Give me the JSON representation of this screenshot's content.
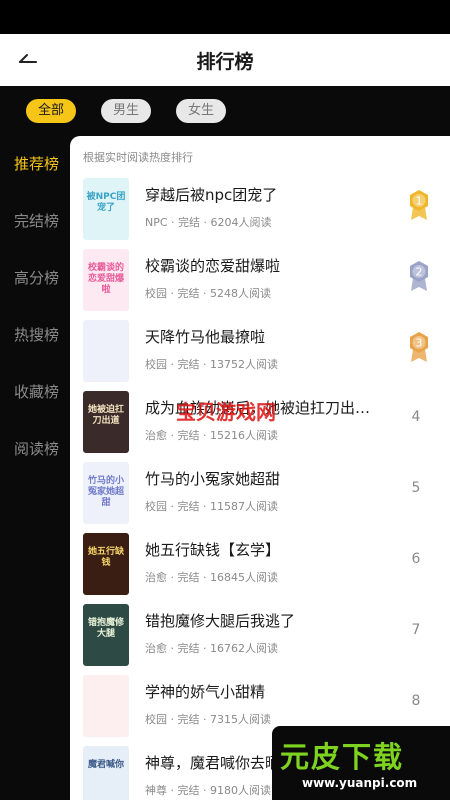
{
  "header": {
    "title": "排行榜"
  },
  "tabs": [
    {
      "label": "全部",
      "active": true
    },
    {
      "label": "男生",
      "active": false
    },
    {
      "label": "女生",
      "active": false
    }
  ],
  "sidebar": [
    {
      "label": "推荐榜",
      "active": true
    },
    {
      "label": "完结榜",
      "active": false
    },
    {
      "label": "高分榜",
      "active": false
    },
    {
      "label": "热搜榜",
      "active": false
    },
    {
      "label": "收藏榜",
      "active": false
    },
    {
      "label": "阅读榜",
      "active": false
    }
  ],
  "panel_hint": "根据实时阅读热度排行",
  "books": [
    {
      "title": "穿越后被npc团宠了",
      "meta": "NPC · 完结 · 6204人阅读",
      "rank": "1",
      "medal": "gold",
      "cover_text": "被NPC团宠了",
      "cover_bg": "#dff4f6",
      "cover_fg": "#3aa3c6"
    },
    {
      "title": "校霸谈的恋爱甜爆啦",
      "meta": "校园 · 完结 · 5248人阅读",
      "rank": "2",
      "medal": "silver",
      "cover_text": "校霸谈的恋爱甜爆啦",
      "cover_bg": "#fde9f1",
      "cover_fg": "#e85d9a"
    },
    {
      "title": "天降竹马他最撩啦",
      "meta": "校园 · 完结 · 13752人阅读",
      "rank": "3",
      "medal": "bronze",
      "cover_text": "",
      "cover_bg": "#eef1f9",
      "cover_fg": "#7a86c5"
    },
    {
      "title": "成为血族幼崽后，她被迫扛刀出…",
      "meta": "治愈 · 完结 · 15216人阅读",
      "rank": "4",
      "medal": "",
      "cover_text": "她被迫扛刀出道",
      "cover_bg": "#3a2a2a",
      "cover_fg": "#f3e3c0"
    },
    {
      "title": "竹马的小冤家她超甜",
      "meta": "校园 · 完结 · 11587人阅读",
      "rank": "5",
      "medal": "",
      "cover_text": "竹马的小冤家她超甜",
      "cover_bg": "#eef0fa",
      "cover_fg": "#6f7bc9"
    },
    {
      "title": "她五行缺钱【玄学】",
      "meta": "治愈 · 完结 · 16845人阅读",
      "rank": "6",
      "medal": "",
      "cover_text": "她五行缺钱",
      "cover_bg": "#3a1e14",
      "cover_fg": "#f5d36a"
    },
    {
      "title": "错抱魔修大腿后我逃了",
      "meta": "治愈 · 完结 · 16762人阅读",
      "rank": "7",
      "medal": "",
      "cover_text": "错抱魔修大腿",
      "cover_bg": "#2d4a44",
      "cover_fg": "#e8f2d8"
    },
    {
      "title": "学神的娇气小甜精",
      "meta": "校园 · 完结 · 7315人阅读",
      "rank": "8",
      "medal": "",
      "cover_text": "",
      "cover_bg": "#fdeef0",
      "cover_fg": "#e57b92"
    },
    {
      "title": "神尊，魔君喊你去晒…",
      "meta": "神尊 · 完结 · 9180人阅读",
      "rank": "",
      "medal": "",
      "cover_text": "魔君喊你",
      "cover_bg": "#e6eef7",
      "cover_fg": "#3c5a8a"
    }
  ],
  "watermarks": {
    "center": "宝贝游戏网",
    "corner_main": "元皮下载",
    "corner_url": "www.yuanpi.com"
  },
  "colors": {
    "accent": "#f5c518",
    "gold": "#f0b62a",
    "silver": "#9aa3c7",
    "bronze": "#e8a34a"
  }
}
